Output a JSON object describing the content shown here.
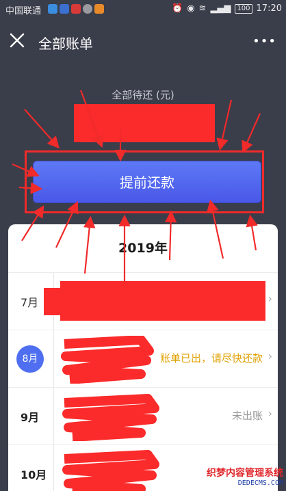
{
  "status_bar": {
    "carrier": "中国联通",
    "battery": "100",
    "time": "17:20"
  },
  "header": {
    "title": "全部账单",
    "more": "•••"
  },
  "summary": {
    "label": "全部待还 (元)"
  },
  "repay_button": {
    "label": "提前还款"
  },
  "bills": {
    "year": "2019年",
    "rows": [
      {
        "month": "7月",
        "status": ""
      },
      {
        "month": "8月",
        "status": "账单已出，请尽快还款"
      },
      {
        "month": "9月",
        "status": "未出账"
      },
      {
        "month": "10月",
        "status": ""
      }
    ]
  },
  "watermark": {
    "line1": "织梦内容管理系统",
    "line2": "DEDECMS.COM"
  },
  "colors": {
    "background": "#3a3d4a",
    "button": "#4f6ff0",
    "annotation_red": "#f12a2a",
    "warning": "#e0a000"
  }
}
